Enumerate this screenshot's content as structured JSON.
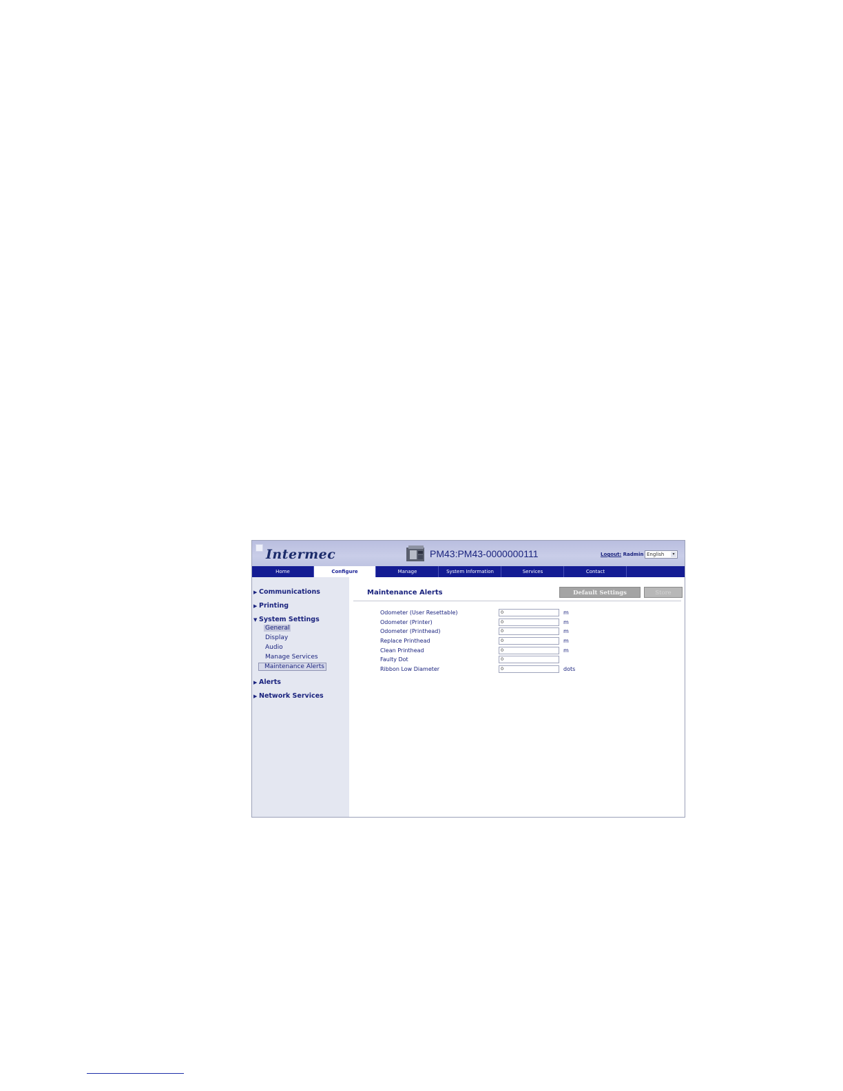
{
  "header": {
    "logo_text": "Intermec",
    "device_title": "PM43:PM43-0000000111",
    "logout_link": "Logout:",
    "logout_user": "Radmin",
    "language": "English"
  },
  "nav": {
    "tabs": [
      {
        "label": "Home"
      },
      {
        "label": "Configure",
        "active": true
      },
      {
        "label": "Manage"
      },
      {
        "label": "System Information"
      },
      {
        "label": "Services"
      },
      {
        "label": "Contact"
      }
    ]
  },
  "sidebar": {
    "communications": "Communications",
    "printing": "Printing",
    "system_settings": "System Settings",
    "general": "General",
    "display": "Display",
    "audio": "Audio",
    "manage_services": "Manage Services",
    "maintenance_alerts": "Maintenance Alerts",
    "alerts": "Alerts",
    "network_services": "Network Services"
  },
  "main": {
    "title": "Maintenance Alerts",
    "default_button": "Default Settings",
    "store_button": "Store",
    "rows": [
      {
        "label": "Odometer (User Resettable)",
        "value": "0",
        "unit": "m"
      },
      {
        "label": "Odometer (Printer)",
        "value": "0",
        "unit": "m"
      },
      {
        "label": "Odometer (Printhead)",
        "value": "0",
        "unit": "m"
      },
      {
        "label": "Replace Printhead",
        "value": "0",
        "unit": "m"
      },
      {
        "label": "Clean Printhead",
        "value": "0",
        "unit": "m"
      },
      {
        "label": "Faulty Dot",
        "value": "0",
        "unit": ""
      },
      {
        "label": "Ribbon Low Diameter",
        "value": "0",
        "unit": "dots"
      }
    ]
  },
  "colors": {
    "nav_bar": "#141c93",
    "text_primary": "#1a237e",
    "sidebar_bg": "#e4e7f1",
    "header_bg": "#c5c9e6"
  },
  "icons": {
    "arrow_collapsed": "▶",
    "arrow_expanded": "▼",
    "select_arrow": "▾"
  }
}
